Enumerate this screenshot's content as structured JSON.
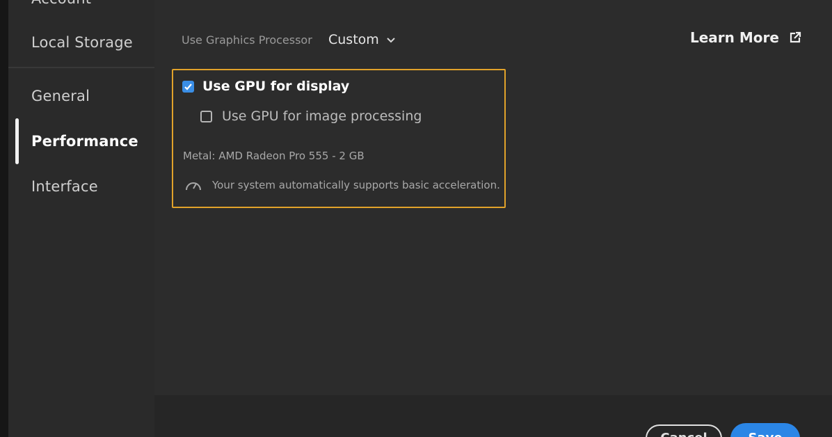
{
  "sidebar": {
    "items": [
      {
        "label": "Account"
      },
      {
        "label": "Local Storage"
      },
      {
        "label": "General"
      },
      {
        "label": "Performance",
        "selected": true
      },
      {
        "label": "Interface"
      }
    ]
  },
  "graphics": {
    "label": "Use Graphics Processor",
    "selected": "Custom"
  },
  "learn_more": {
    "label": "Learn More",
    "icon": "external-link-icon"
  },
  "gpu_options": {
    "display": {
      "label": "Use GPU for display",
      "checked": true
    },
    "image_processing": {
      "label": "Use GPU for image processing",
      "checked": false
    },
    "gpu_info": "Metal: AMD Radeon Pro 555 - 2 GB",
    "acceleration_note": "Your system automatically supports basic acceleration.",
    "acceleration_icon": "speedometer-icon"
  },
  "footer": {
    "cancel_label": "Cancel",
    "save_label": "Save"
  },
  "colors": {
    "accent": "#2b86e6",
    "highlight_border": "#e2a32a",
    "checkbox_checked": "#3a8ee6"
  }
}
